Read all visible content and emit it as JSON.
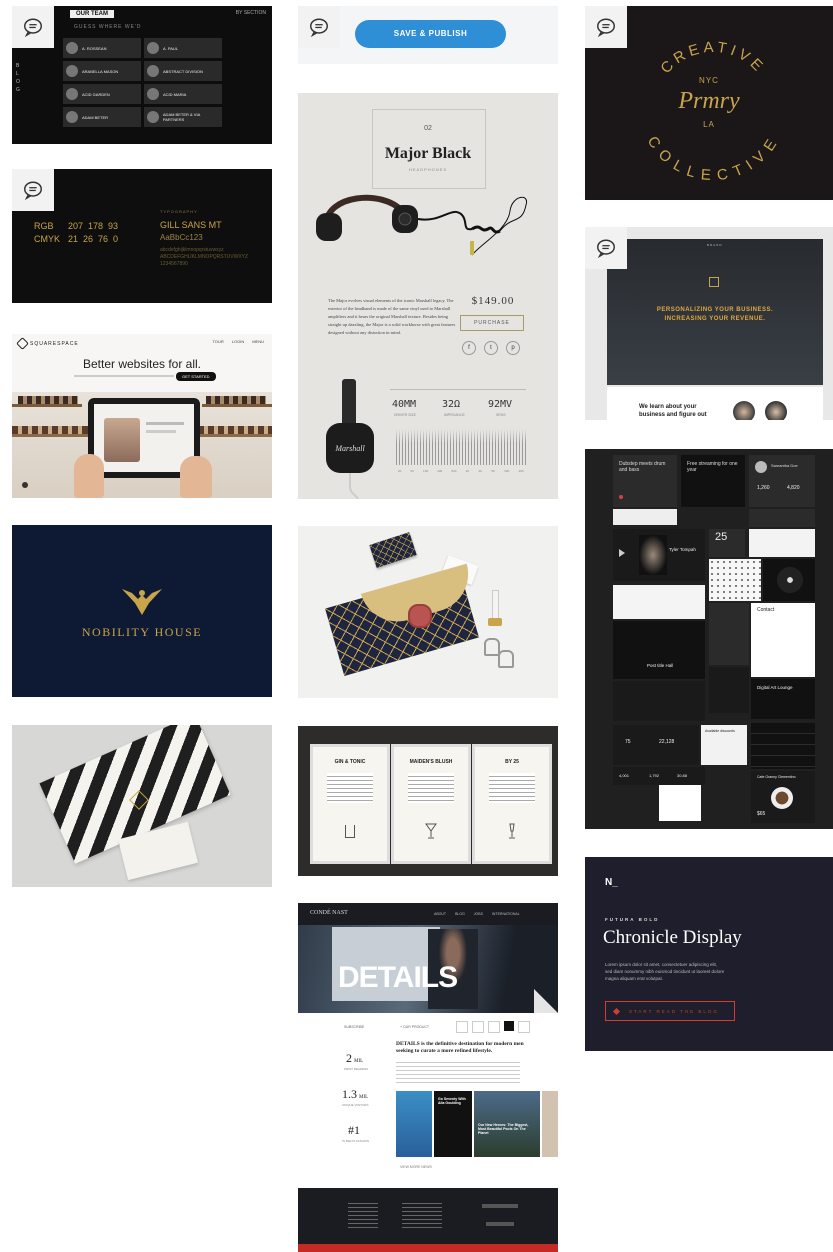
{
  "comment_icon": "speech-bubble-icon",
  "colors": {
    "publish_blue": "#2f8fd6",
    "gold": "#c8a44a",
    "navy": "#0e1a33",
    "chronicle_red": "#d63b2f",
    "dark_tile": "#111111"
  },
  "tile_team": {
    "header": "OUR TEAM",
    "subtitle": "GUESS WHERE WE'D",
    "right_label": "BY SECTION",
    "side_letters": "B L O G",
    "members": [
      {
        "name": "A. ROSSEAN"
      },
      {
        "name": "A. PAUL"
      },
      {
        "name": "ARABELLA MASON"
      },
      {
        "name": "ABSTRACT DIVISION"
      },
      {
        "name": "ACID GARDEN"
      },
      {
        "name": "ACID MARIA"
      },
      {
        "name": "ADAM BETER"
      },
      {
        "name": "ADAM BETER & VIA PARTNERS"
      }
    ]
  },
  "tile_colors": {
    "rgb_label": "RGB",
    "rgb_values": "207  178  93",
    "cmyk_label": "CMYK",
    "cmyk_values": "21  26  76  0",
    "typo_label": "TYPOGRAPHY",
    "font_name": "GILL SANS MT",
    "font_sample": "AaBbCc123",
    "font_chars": "abcdefghijklmnopqrstuvwxyz ABCDEFGHIJKLMNOPQRSTUVWXYZ 1234567890"
  },
  "tile_squarespace": {
    "logo": "SQUARESPACE",
    "nav": [
      "TOUR",
      "LOGIN",
      "MENU"
    ],
    "headline": "Better websites for all.",
    "cta": "GET STARTED"
  },
  "tile_nobility": {
    "brand": "NOBILITY HOUSE"
  },
  "tile_publish": {
    "button": "SAVE & PUBLISH"
  },
  "tile_major": {
    "number": "02",
    "title": "Major Black",
    "subtitle": "HEADPHONES",
    "description": "The Major evolves visual elements of the iconic Marshall legacy. The exterior of the headband is made of the same vinyl used to Marshall amplifiers and it bears the original Marshall texture. Besides being straight up dazzling, the Major is a solid workhorse with great features designed without any distortion in mind.",
    "price": "$149.00",
    "purchase": "PURCHASE",
    "social": [
      "f",
      "t",
      "p"
    ],
    "spec1_value": "40MM",
    "spec1_label": "DRIVER SIZE",
    "spec2_value": "32Ω",
    "spec2_label": "IMPEDANCE",
    "spec3_value": "92MV",
    "spec3_label": "SENS",
    "freq_labels": [
      "20",
      "50",
      "100",
      "200",
      "500",
      "1K",
      "2K",
      "5K",
      "10K",
      "20K"
    ]
  },
  "tile_dinner": {
    "menus": [
      {
        "title": "GIN & TONIC",
        "glass": "tumbler"
      },
      {
        "title": "MAIDEN'S BLUSH",
        "glass": "cocktail"
      },
      {
        "title": "BY 25",
        "glass": "flute"
      }
    ]
  },
  "tile_details": {
    "logo": "CONDÉ NAST",
    "nav": [
      "ABOUT",
      "BLOG",
      "JOBS",
      "INTERNATIONAL"
    ],
    "hero_word": "DETAILS",
    "bar_left": "SUBSCRIBE",
    "bar_mid": "+ OUR PRODUCT",
    "stat1_value": "2",
    "stat1_unit": "MIL",
    "stat1_label": "PRINT READERS",
    "stat2_value": "1.3",
    "stat2_unit": "MIL",
    "stat2_label": "UNIQUE VISITORS",
    "stat3_value": "#1",
    "stat3_label": "IN MEN'S FASHION",
    "headline": "DETAILS is the definitive destination for modern men seeking to curate a more refined lifestyle.",
    "card1": "Go Seventy With Alia Goulding",
    "card2": "Our New Heroes: The Biggest, Most Beautiful Pools On The Planet",
    "more": "VIEW MORE NEWS"
  },
  "tile_creative": {
    "top": "CREATIVE",
    "city": "NYC",
    "script": "Prmry",
    "la": "LA",
    "bottom": "COLLECTIVE"
  },
  "tile_personal": {
    "nav": "BRAND",
    "headline1": "PERSONALIZING YOUR BUSINESS.",
    "headline2": "INCREASING YOUR REVENUE.",
    "learn": "We learn about your business and figure out"
  },
  "tile_dashboard": {
    "card1": "Dubstep meets drum and bass",
    "card2": "Free streaming for one year",
    "profile_name": "Samantha Doe",
    "count1": "1,260",
    "count2": "4,820",
    "player_title": "Tyler Tompah",
    "calendar_day": "25",
    "post_title": "Post title Hall",
    "contact": "Contact",
    "lecture": "Digital Art Lounge",
    "stat_a": "75",
    "stat_b": "22,128",
    "stat_c": "4,001",
    "stat_d": "1,792",
    "stat_e": "30.88",
    "available": "Available discounts",
    "coffee": "Cafe Granny Clementino",
    "price": "$65"
  },
  "tile_chronicle": {
    "logo": "N_",
    "kicker": "FUTURA BOLD",
    "title": "Chronicle Display",
    "body": "Lorem ipsum dolor sit amet, consectetuer adipiscing elit, sed diam nonummy nibh euismod tincidunt ut laoreet dolore magna aliquam erat volutpat.",
    "cta": "START READ THE BLOG"
  }
}
